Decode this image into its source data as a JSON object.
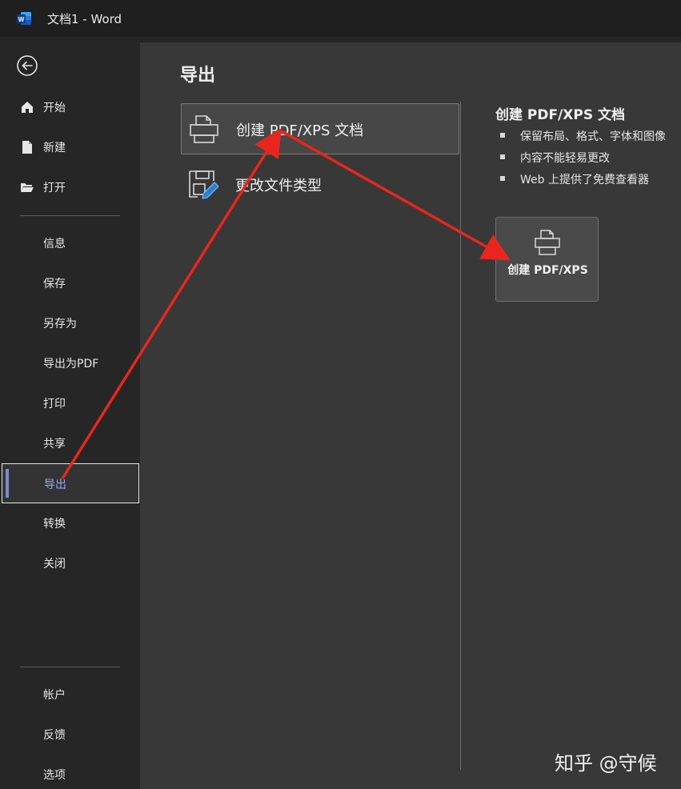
{
  "titlebar": {
    "app_name": "Word",
    "title": "文档1  -  Word"
  },
  "sidebar": {
    "top_items": [
      {
        "label": "开始",
        "icon": "home-icon"
      },
      {
        "label": "新建",
        "icon": "new-document-icon"
      },
      {
        "label": "打开",
        "icon": "folder-open-icon"
      }
    ],
    "middle_items": [
      {
        "label": "信息"
      },
      {
        "label": "保存"
      },
      {
        "label": "另存为"
      },
      {
        "label": "导出为PDF"
      },
      {
        "label": "打印"
      },
      {
        "label": "共享"
      },
      {
        "label": "导出",
        "selected": true
      },
      {
        "label": "转换"
      },
      {
        "label": "关闭"
      }
    ],
    "bottom_items": [
      {
        "label": "帐户"
      },
      {
        "label": "反馈"
      },
      {
        "label": "选项"
      }
    ]
  },
  "main": {
    "title": "导出",
    "options": [
      {
        "label": "创建 PDF/XPS 文档",
        "icon": "printer-document-icon",
        "selected": true
      },
      {
        "label": "更改文件类型",
        "icon": "file-type-edit-icon"
      }
    ],
    "detail": {
      "title": "创建 PDF/XPS 文档",
      "bullets": [
        "保留布局、格式、字体和图像",
        "内容不能轻易更改",
        "Web 上提供了免费查看器"
      ],
      "button_label": "创建 PDF/XPS"
    }
  },
  "watermark": "知乎 @守候",
  "colors": {
    "background": "#383838",
    "sidebar": "#262626",
    "annotation_arrow": "#e8261e",
    "selected_accent": "#7d8ac9"
  }
}
